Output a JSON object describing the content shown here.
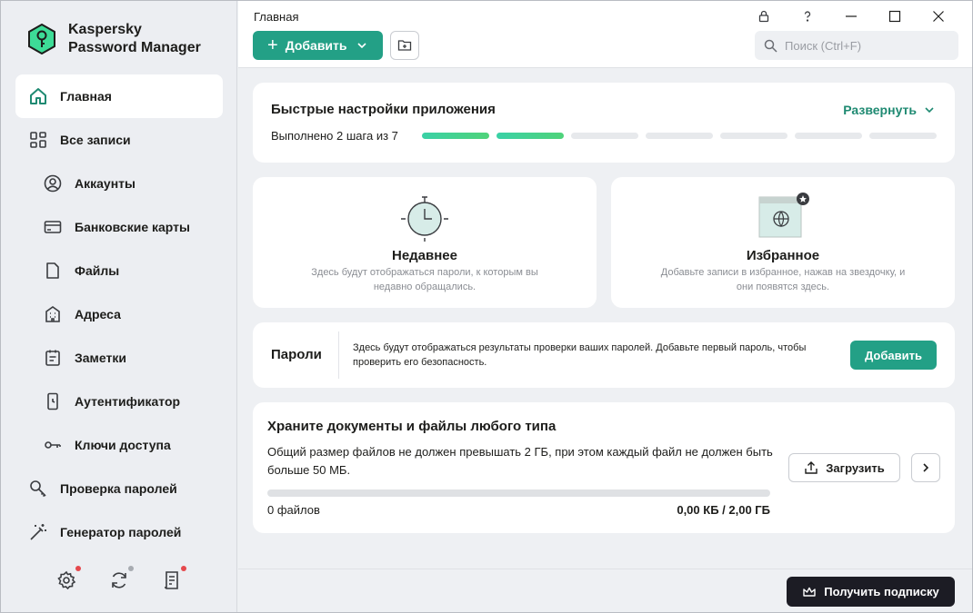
{
  "app": {
    "name_line1": "Kaspersky",
    "name_line2": "Password Manager",
    "accent": "#23a086",
    "icon": "kaspersky-key-shield-icon"
  },
  "sidebar": {
    "items": [
      {
        "label": "Главная",
        "icon": "home-icon",
        "active": true
      },
      {
        "label": "Все записи",
        "icon": "grid-icon"
      },
      {
        "label": "Аккаунты",
        "icon": "user-circle-icon"
      },
      {
        "label": "Банковские карты",
        "icon": "card-icon"
      },
      {
        "label": "Файлы",
        "icon": "file-icon"
      },
      {
        "label": "Адреса",
        "icon": "building-icon"
      },
      {
        "label": "Заметки",
        "icon": "notepad-icon"
      },
      {
        "label": "Аутентификатор",
        "icon": "phone-icon"
      },
      {
        "label": "Ключи доступа",
        "icon": "key-icon"
      },
      {
        "label": "Проверка паролей",
        "icon": "magnifier-key-icon"
      },
      {
        "label": "Генератор паролей",
        "icon": "magic-wand-icon"
      }
    ],
    "bottom": [
      {
        "icon": "gear-icon",
        "badge_color": "#e5484d"
      },
      {
        "icon": "sync-icon",
        "badge_color": "#a7abb1"
      },
      {
        "icon": "report-icon",
        "badge_color": "#e5484d"
      }
    ]
  },
  "header": {
    "title": "Главная",
    "add_label": "Добавить",
    "search_placeholder": "Поиск (Ctrl+F)"
  },
  "quick_setup": {
    "title": "Быстрые настройки приложения",
    "expand_label": "Развернуть",
    "progress_label": "Выполнено 2 шага из 7",
    "steps_done": 2,
    "steps_total": 7
  },
  "recent": {
    "title": "Недавнее",
    "description": "Здесь будут отображаться пароли, к которым вы недавно обращались."
  },
  "favorites": {
    "title": "Избранное",
    "description": "Добавьте записи в избранное, нажав на звездочку, и они появятся здесь."
  },
  "passwords": {
    "title": "Пароли",
    "description": "Здесь будут отображаться результаты проверки ваших паролей. Добавьте первый пароль, чтобы проверить его безопасность.",
    "add_label": "Добавить"
  },
  "documents": {
    "title": "Храните документы и файлы любого типа",
    "description": "Общий размер файлов не должен превышать 2 ГБ, при этом каждый файл не должен быть больше 50 МБ.",
    "count_label": "0 файлов",
    "size_label": "0,00 КБ / 2,00 ГБ",
    "used_fraction": 0,
    "upload_label": "Загрузить"
  },
  "footer": {
    "subscribe_label": "Получить подписку"
  }
}
